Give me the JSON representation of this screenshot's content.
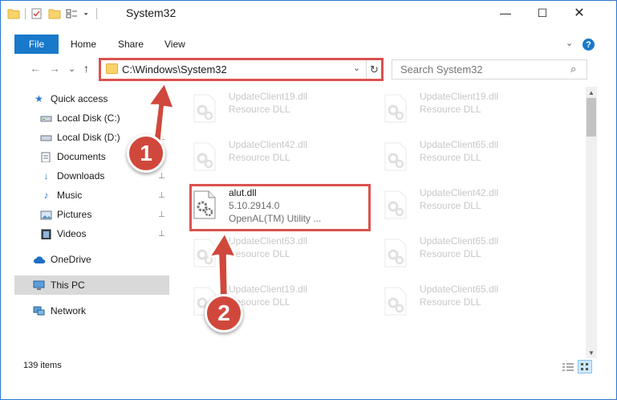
{
  "window": {
    "title": "System32",
    "minimize_glyph": "—",
    "maximize_glyph": "☐",
    "close_glyph": "✕"
  },
  "ribbon": {
    "tabs": [
      {
        "label": "File",
        "active": true
      },
      {
        "label": "Home"
      },
      {
        "label": "Share"
      },
      {
        "label": "View"
      }
    ],
    "help_glyph": "?",
    "expand_glyph": "⌄"
  },
  "nav": {
    "back": "←",
    "forward": "→",
    "recent": "⌄",
    "up": "↑"
  },
  "address": {
    "path": "C:\\Windows\\System32",
    "dropdown_glyph": "⌄",
    "refresh_glyph": "↻"
  },
  "search": {
    "placeholder": "Search System32",
    "icon": "⌕"
  },
  "sidebar": {
    "items": [
      {
        "label": "Quick access",
        "icon": "star-icon",
        "pinned": false
      },
      {
        "label": "Local Disk (C:)",
        "icon": "drive-icon",
        "pinned": true
      },
      {
        "label": "Local Disk (D:)",
        "icon": "drive-icon",
        "pinned": true
      },
      {
        "label": "Documents",
        "icon": "documents-icon",
        "pinned": true
      },
      {
        "label": "Downloads",
        "icon": "download-icon",
        "pinned": true
      },
      {
        "label": "Music",
        "icon": "music-icon",
        "pinned": true
      },
      {
        "label": "Pictures",
        "icon": "pictures-icon",
        "pinned": true
      },
      {
        "label": "Videos",
        "icon": "videos-icon",
        "pinned": true
      },
      {
        "label": "OneDrive",
        "icon": "cloud-icon",
        "pinned": false
      },
      {
        "label": "This PC",
        "icon": "computer-icon",
        "pinned": false,
        "selected": true
      },
      {
        "label": "Network",
        "icon": "network-icon",
        "pinned": false
      }
    ],
    "pin_glyph": "📌"
  },
  "files": [
    {
      "name": "UpdateClient19.dll",
      "desc": "Resource DLL"
    },
    {
      "name": "UpdateClient19.dll",
      "desc": "Resource DLL"
    },
    {
      "name": "UpdateClient42.dll",
      "desc": "Resource DLL"
    },
    {
      "name": "UpdateClient65.dll",
      "desc": "Resource DLL"
    },
    {
      "name": "alut.dll",
      "version": "5.10.2914.0",
      "desc": "OpenAL(TM) Utility ...",
      "highlighted": true
    },
    {
      "name": "UpdateClient42.dll",
      "desc": "Resource DLL"
    },
    {
      "name": "UpdateClient63.dll",
      "desc": "Resource DLL"
    },
    {
      "name": "UpdateClient65.dll",
      "desc": "Resource DLL"
    },
    {
      "name": "UpdateClient19.dll",
      "desc": "Resource DLL"
    },
    {
      "name": "UpdateClient65.dll",
      "desc": "Resource DLL"
    }
  ],
  "status": {
    "item_count": "139 items"
  },
  "annotations": {
    "step1": "1",
    "step2": "2",
    "highlight_color": "#d9534f"
  },
  "colors": {
    "accent": "#1979ca",
    "selection": "#d9d9d9",
    "callout": "#d0483b"
  }
}
